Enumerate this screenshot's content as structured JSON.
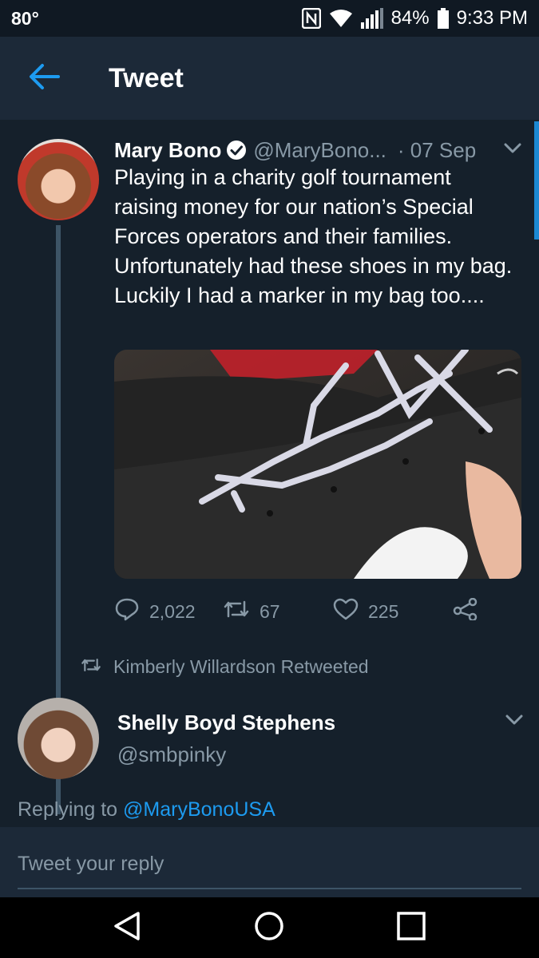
{
  "status_bar": {
    "temperature": "80°",
    "battery": "84%",
    "time": "9:33 PM",
    "icons": [
      "nfc-icon",
      "wifi-icon",
      "signal-icon",
      "battery-icon"
    ]
  },
  "app_bar": {
    "back_icon": "arrow-left-icon",
    "title": "Tweet"
  },
  "tweet": {
    "author_name": "Mary Bono",
    "handle": "@MaryBono...",
    "date": "· 07 Sep",
    "text": "Playing in a charity golf tournament raising money for our nation’s Special Forces operators and their families. Unfortunately had these shoes in my bag. Luckily I had a marker in my bag too....",
    "media_description_icon": "photo",
    "actions": {
      "replies": "2,022",
      "retweets": "67",
      "likes": "225"
    }
  },
  "retweet_notice": {
    "text": "Kimberly Willardson Retweeted"
  },
  "reply_tweet": {
    "author_name": "Shelly Boyd Stephens",
    "handle": "@smbpinky",
    "replying_prefix": "Replying to ",
    "replying_to": "@MaryBonoUSA"
  },
  "composer": {
    "placeholder": "Tweet your reply"
  },
  "colors": {
    "background": "#15202b",
    "header": "#1c2938",
    "accent": "#1d9bf0",
    "secondary_text": "#8899a6"
  }
}
